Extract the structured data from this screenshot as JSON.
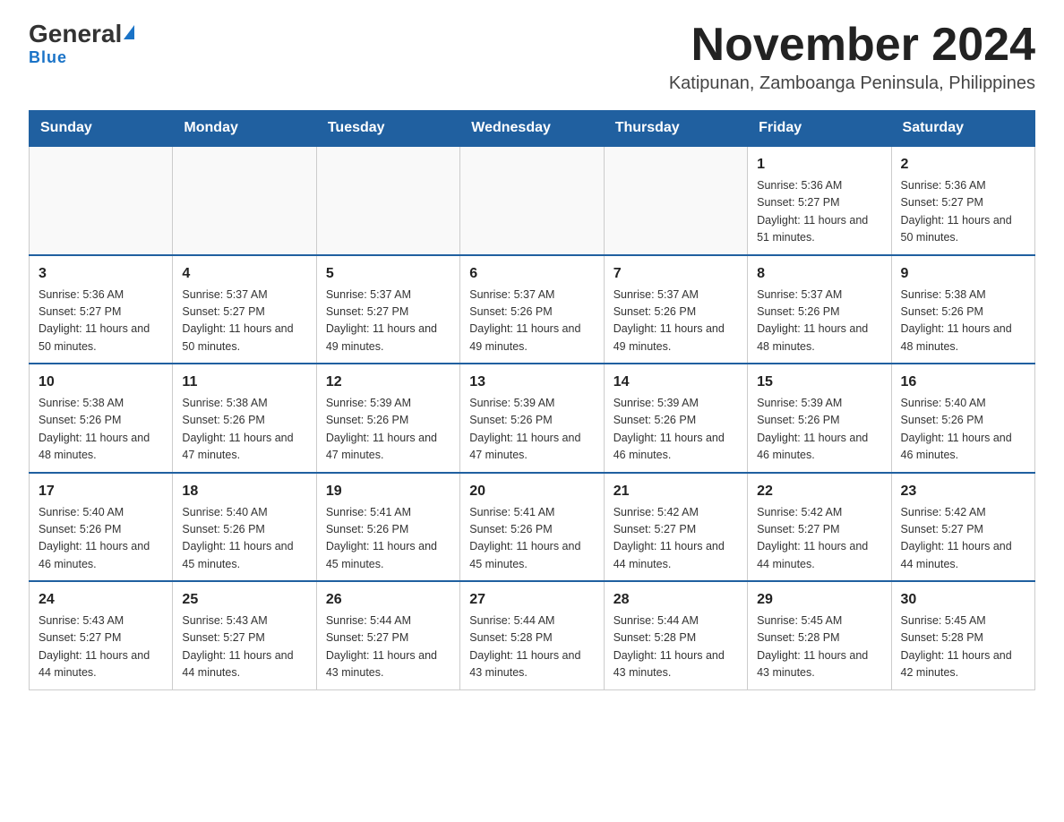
{
  "logo": {
    "main_text": "General",
    "sub_text": "Blue"
  },
  "header": {
    "month_year": "November 2024",
    "location": "Katipunan, Zamboanga Peninsula, Philippines"
  },
  "days_of_week": [
    "Sunday",
    "Monday",
    "Tuesday",
    "Wednesday",
    "Thursday",
    "Friday",
    "Saturday"
  ],
  "weeks": [
    [
      {
        "day": "",
        "info": ""
      },
      {
        "day": "",
        "info": ""
      },
      {
        "day": "",
        "info": ""
      },
      {
        "day": "",
        "info": ""
      },
      {
        "day": "",
        "info": ""
      },
      {
        "day": "1",
        "info": "Sunrise: 5:36 AM\nSunset: 5:27 PM\nDaylight: 11 hours and 51 minutes."
      },
      {
        "day": "2",
        "info": "Sunrise: 5:36 AM\nSunset: 5:27 PM\nDaylight: 11 hours and 50 minutes."
      }
    ],
    [
      {
        "day": "3",
        "info": "Sunrise: 5:36 AM\nSunset: 5:27 PM\nDaylight: 11 hours and 50 minutes."
      },
      {
        "day": "4",
        "info": "Sunrise: 5:37 AM\nSunset: 5:27 PM\nDaylight: 11 hours and 50 minutes."
      },
      {
        "day": "5",
        "info": "Sunrise: 5:37 AM\nSunset: 5:27 PM\nDaylight: 11 hours and 49 minutes."
      },
      {
        "day": "6",
        "info": "Sunrise: 5:37 AM\nSunset: 5:26 PM\nDaylight: 11 hours and 49 minutes."
      },
      {
        "day": "7",
        "info": "Sunrise: 5:37 AM\nSunset: 5:26 PM\nDaylight: 11 hours and 49 minutes."
      },
      {
        "day": "8",
        "info": "Sunrise: 5:37 AM\nSunset: 5:26 PM\nDaylight: 11 hours and 48 minutes."
      },
      {
        "day": "9",
        "info": "Sunrise: 5:38 AM\nSunset: 5:26 PM\nDaylight: 11 hours and 48 minutes."
      }
    ],
    [
      {
        "day": "10",
        "info": "Sunrise: 5:38 AM\nSunset: 5:26 PM\nDaylight: 11 hours and 48 minutes."
      },
      {
        "day": "11",
        "info": "Sunrise: 5:38 AM\nSunset: 5:26 PM\nDaylight: 11 hours and 47 minutes."
      },
      {
        "day": "12",
        "info": "Sunrise: 5:39 AM\nSunset: 5:26 PM\nDaylight: 11 hours and 47 minutes."
      },
      {
        "day": "13",
        "info": "Sunrise: 5:39 AM\nSunset: 5:26 PM\nDaylight: 11 hours and 47 minutes."
      },
      {
        "day": "14",
        "info": "Sunrise: 5:39 AM\nSunset: 5:26 PM\nDaylight: 11 hours and 46 minutes."
      },
      {
        "day": "15",
        "info": "Sunrise: 5:39 AM\nSunset: 5:26 PM\nDaylight: 11 hours and 46 minutes."
      },
      {
        "day": "16",
        "info": "Sunrise: 5:40 AM\nSunset: 5:26 PM\nDaylight: 11 hours and 46 minutes."
      }
    ],
    [
      {
        "day": "17",
        "info": "Sunrise: 5:40 AM\nSunset: 5:26 PM\nDaylight: 11 hours and 46 minutes."
      },
      {
        "day": "18",
        "info": "Sunrise: 5:40 AM\nSunset: 5:26 PM\nDaylight: 11 hours and 45 minutes."
      },
      {
        "day": "19",
        "info": "Sunrise: 5:41 AM\nSunset: 5:26 PM\nDaylight: 11 hours and 45 minutes."
      },
      {
        "day": "20",
        "info": "Sunrise: 5:41 AM\nSunset: 5:26 PM\nDaylight: 11 hours and 45 minutes."
      },
      {
        "day": "21",
        "info": "Sunrise: 5:42 AM\nSunset: 5:27 PM\nDaylight: 11 hours and 44 minutes."
      },
      {
        "day": "22",
        "info": "Sunrise: 5:42 AM\nSunset: 5:27 PM\nDaylight: 11 hours and 44 minutes."
      },
      {
        "day": "23",
        "info": "Sunrise: 5:42 AM\nSunset: 5:27 PM\nDaylight: 11 hours and 44 minutes."
      }
    ],
    [
      {
        "day": "24",
        "info": "Sunrise: 5:43 AM\nSunset: 5:27 PM\nDaylight: 11 hours and 44 minutes."
      },
      {
        "day": "25",
        "info": "Sunrise: 5:43 AM\nSunset: 5:27 PM\nDaylight: 11 hours and 44 minutes."
      },
      {
        "day": "26",
        "info": "Sunrise: 5:44 AM\nSunset: 5:27 PM\nDaylight: 11 hours and 43 minutes."
      },
      {
        "day": "27",
        "info": "Sunrise: 5:44 AM\nSunset: 5:28 PM\nDaylight: 11 hours and 43 minutes."
      },
      {
        "day": "28",
        "info": "Sunrise: 5:44 AM\nSunset: 5:28 PM\nDaylight: 11 hours and 43 minutes."
      },
      {
        "day": "29",
        "info": "Sunrise: 5:45 AM\nSunset: 5:28 PM\nDaylight: 11 hours and 43 minutes."
      },
      {
        "day": "30",
        "info": "Sunrise: 5:45 AM\nSunset: 5:28 PM\nDaylight: 11 hours and 42 minutes."
      }
    ]
  ]
}
